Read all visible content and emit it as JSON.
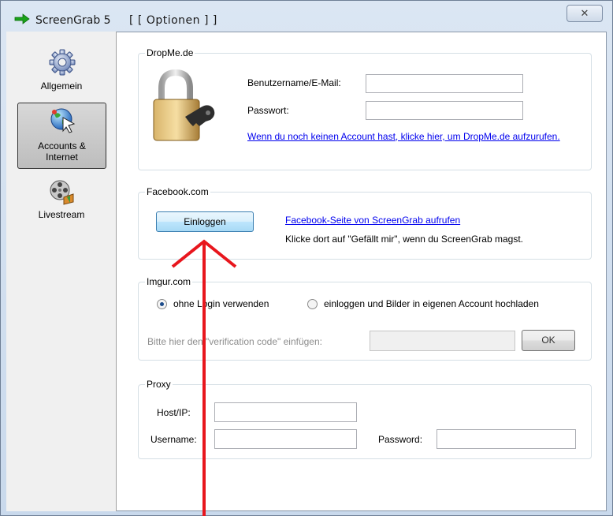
{
  "window": {
    "app_title": "ScreenGrab 5",
    "section_title": "[ [ Optionen ] ]",
    "close_label": "✕"
  },
  "sidebar": {
    "items": [
      {
        "label": "Allgemein",
        "icon": "gear-icon"
      },
      {
        "label": "Accounts &\nInternet",
        "icon": "globe-cursor-icon",
        "selected": true
      },
      {
        "label": "Livestream",
        "icon": "film-reel-icon"
      }
    ]
  },
  "dropme": {
    "title": "DropMe.de",
    "username_label": "Benutzername/E-Mail:",
    "username_value": "",
    "password_label": "Passwort:",
    "password_value": "",
    "signup_link": "Wenn du noch keinen Account hast, klicke hier, um DropMe.de aufzurufen."
  },
  "facebook": {
    "title": "Facebook.com",
    "login_button": "Einloggen",
    "page_link": "Facebook-Seite von ScreenGrab aufrufen",
    "hint": "Klicke dort auf \"Gefällt mir\", wenn du ScreenGrab magst."
  },
  "imgur": {
    "title": "Imgur.com",
    "option_anonymous": "ohne Login verwenden",
    "option_account": "einloggen und Bilder in eigenen Account hochladen",
    "selected_option": "ohne Login verwenden",
    "verification_label": "Bitte hier den \"verification code\" einfügen:",
    "verification_value": "",
    "ok_button": "OK"
  },
  "proxy": {
    "title": "Proxy",
    "host_label": "Host/IP:",
    "host_value": "",
    "username_label": "Username:",
    "username_value": "",
    "password_label": "Password:",
    "password_value": ""
  },
  "colors": {
    "annotation_arrow": "#e8161d",
    "link": "#0000ee",
    "title_arrow": "#1aa31a"
  }
}
